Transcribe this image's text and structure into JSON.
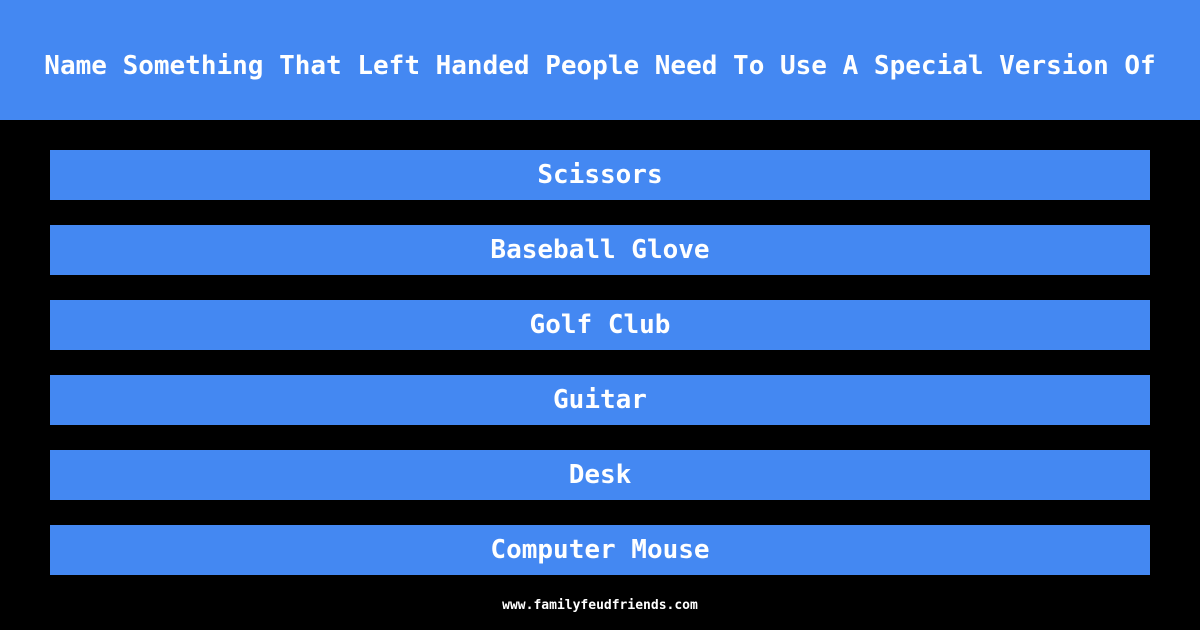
{
  "question": "Name Something That Left Handed People Need To Use A Special Version Of",
  "answers": [
    {
      "label": "Scissors"
    },
    {
      "label": "Baseball Glove"
    },
    {
      "label": "Golf Club"
    },
    {
      "label": "Guitar"
    },
    {
      "label": "Desk"
    },
    {
      "label": "Computer Mouse"
    }
  ],
  "footer": "www.familyfeudfriends.com",
  "colors": {
    "accent": "#4488f2",
    "background": "#000000",
    "text": "#ffffff"
  }
}
